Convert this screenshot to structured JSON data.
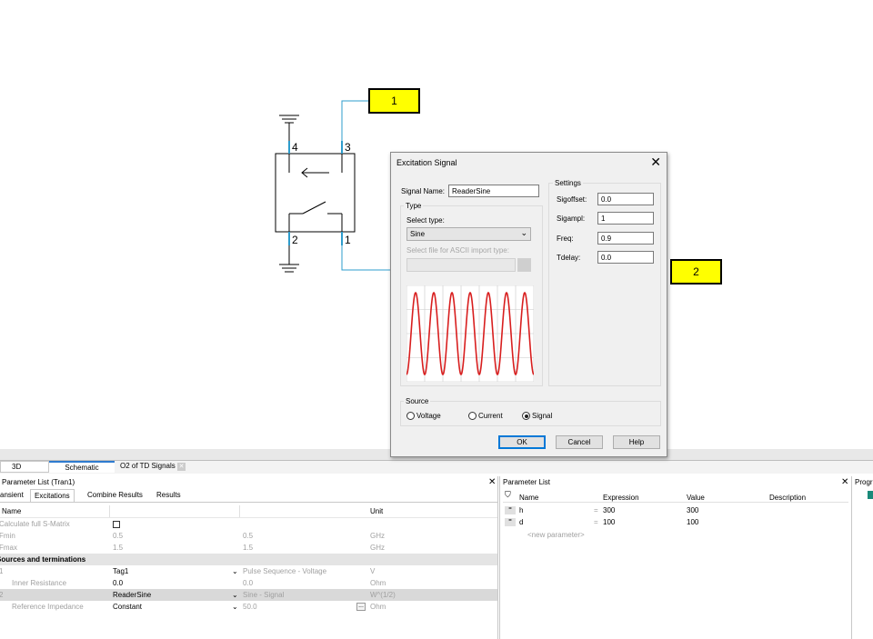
{
  "ports": {
    "port1": "1",
    "port2": "2"
  },
  "pins": {
    "p4": "4",
    "p3": "3",
    "p2": "2",
    "p1": "1"
  },
  "dialog": {
    "title": "Excitation Signal",
    "close_icon": "close-icon",
    "signal_name_label": "Signal Name:",
    "signal_name_value": "ReaderSine",
    "type_group": "Type",
    "select_type_label": "Select type:",
    "select_type_value": "Sine",
    "ascii_label": "Select file for ASCII import type:",
    "settings_group": "Settings",
    "settings": [
      {
        "label": "Sigoffset:",
        "value": "0.0"
      },
      {
        "label": "Sigampl:",
        "value": "1"
      },
      {
        "label": "Freq:",
        "value": "0.9"
      },
      {
        "label": "Tdelay:",
        "value": "0.0"
      }
    ],
    "source_group": "Source",
    "source_options": [
      "Voltage",
      "Current",
      "Signal"
    ],
    "source_selected": "Signal",
    "ok": "OK",
    "cancel": "Cancel",
    "help": "Help"
  },
  "doc_tabs": [
    "3D",
    "Schematic",
    "O2 of TD Signals"
  ],
  "left_panel": {
    "title": "Parameter List (Tran1)",
    "tabs": [
      "ansient",
      "Excitations",
      "Combine Results",
      "Results"
    ],
    "header": {
      "name": "Name",
      "unit": "Unit"
    },
    "rows": [
      {
        "name": "Calculate full S-Matrix",
        "v1": "",
        "v2": "",
        "unit": ""
      },
      {
        "name": "Fmin",
        "v1": "0.5",
        "v2": "0.5",
        "unit": "GHz"
      },
      {
        "name": "Fmax",
        "v1": "1.5",
        "v2": "1.5",
        "unit": "GHz"
      }
    ],
    "section": "Sources and terminations",
    "source_rows": [
      {
        "id": "1",
        "name": "",
        "v1": "Tag1",
        "v2": "Pulse Sequence - Voltage",
        "unit": "V"
      },
      {
        "id": "",
        "name": "Inner Resistance",
        "v1": "0.0",
        "v2": "0.0",
        "unit": "Ohm"
      },
      {
        "id": "2",
        "name": "",
        "v1": "ReaderSine",
        "v2": "Sine - Signal",
        "unit": "W^(1/2)"
      },
      {
        "id": "",
        "name": "Reference Impedance",
        "v1": "Constant",
        "v2": "50.0",
        "unit": "Ohm"
      }
    ]
  },
  "right_panel": {
    "title": "Parameter List",
    "headers": [
      "Name",
      "Expression",
      "Value",
      "Description"
    ],
    "rows": [
      {
        "name": "h",
        "expr": "300",
        "value": "300"
      },
      {
        "name": "d",
        "expr": "100",
        "value": "100"
      }
    ],
    "new_param": "<new parameter>"
  },
  "far_right": {
    "title": "Progr"
  },
  "chart_data": {
    "type": "line",
    "title": "",
    "xlabel": "",
    "ylabel": "",
    "series": [
      {
        "name": "",
        "cycles": 7,
        "color": "#d81e1e"
      }
    ],
    "grid": true
  }
}
